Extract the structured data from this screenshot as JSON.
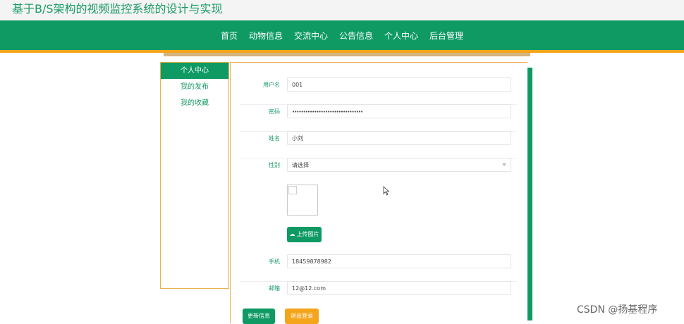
{
  "site": {
    "title": "基于B/S架构的视频监控系统的设计与实现"
  },
  "nav": {
    "items": [
      "首页",
      "动物信息",
      "交流中心",
      "公告信息",
      "个人中心",
      "后台管理"
    ]
  },
  "sidebar": {
    "items": [
      {
        "label": "个人中心"
      },
      {
        "label": "我的发布"
      },
      {
        "label": "我的收藏"
      }
    ]
  },
  "form": {
    "username": {
      "label": "用户名",
      "value": "001"
    },
    "password": {
      "label": "密码",
      "value": "••••••••••••••••••••••••••••••••"
    },
    "name": {
      "label": "姓名",
      "value": "小刘"
    },
    "gender": {
      "label": "性别",
      "value": "请选择"
    },
    "upload_label": "上传图片",
    "phone": {
      "label": "手机",
      "value": "18459878982"
    },
    "email": {
      "label": "邮箱",
      "value": "12@12.com"
    },
    "update_label": "更新信息",
    "logout_label": "退出登录"
  },
  "watermark": "CSDN @扬基程序",
  "colors": {
    "primary": "#0f9a64",
    "accent": "#f4a51c"
  }
}
